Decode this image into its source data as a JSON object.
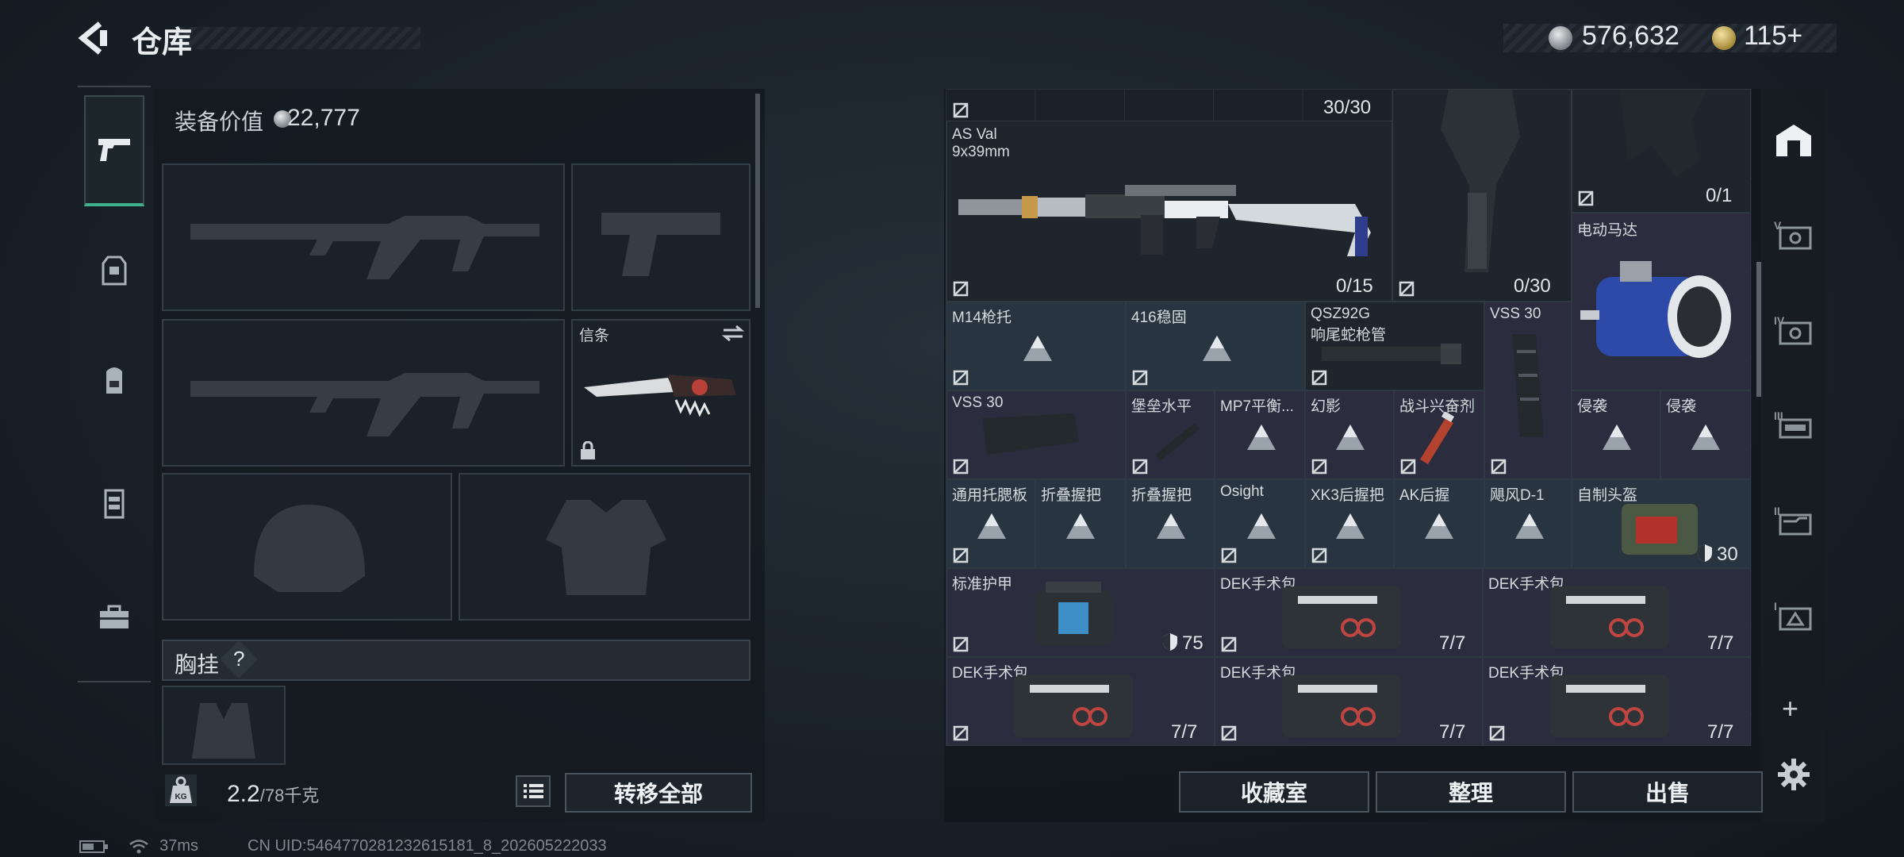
{
  "header": {
    "title": "仓库",
    "money": "576,632",
    "tickets": "115",
    "tickets_plus": "+"
  },
  "left_nav": [
    "gun-icon",
    "backpack-armor-icon",
    "backpack-icon",
    "vest-icon",
    "toolbox-icon"
  ],
  "equipment": {
    "value_label": "装备价值",
    "value": "22,777",
    "melee_label": "信条",
    "chest_rig_label": "胸挂",
    "chest_rig_help": "?",
    "weight": "2.2",
    "weight_max": "/78千克",
    "weight_badge": "KG",
    "transfer_all": "转移全部"
  },
  "stash": {
    "top_count": "30/30",
    "items": [
      {
        "name": "AS Val",
        "sub": "9x39mm",
        "count": "0/15"
      },
      {
        "name": "",
        "count": "0/30"
      },
      {
        "name": "",
        "count": "0/1"
      },
      {
        "name": "电动马达"
      },
      {
        "name": "M14枪托"
      },
      {
        "name": "416稳固"
      },
      {
        "name": "QSZ92G",
        "sub": "响尾蛇枪管"
      },
      {
        "name": "VSS 30"
      },
      {
        "name": "VSS 30"
      },
      {
        "name": "堡垒水平"
      },
      {
        "name": "MP7平衡..."
      },
      {
        "name": "幻影"
      },
      {
        "name": "战斗兴奋剂"
      },
      {
        "name": "侵袭"
      },
      {
        "name": "侵袭"
      },
      {
        "name": "通用托腮板"
      },
      {
        "name": "折叠握把"
      },
      {
        "name": "折叠握把"
      },
      {
        "name": "Osight"
      },
      {
        "name": "XK3后握把"
      },
      {
        "name": "AK后握"
      },
      {
        "name": "飓风D-1"
      },
      {
        "name": "自制头盔",
        "count": "30"
      },
      {
        "name": "标准护甲",
        "count": "75"
      },
      {
        "name": "DEK手术包",
        "count": "7/7"
      },
      {
        "name": "DEK手术包",
        "count": "7/7"
      },
      {
        "name": "DEK手术包",
        "count": "7/7"
      },
      {
        "name": "DEK手术包",
        "count": "7/7"
      },
      {
        "name": "DEK手术包",
        "count": "7/7"
      }
    ],
    "buttons": [
      "收藏室",
      "整理",
      "出售"
    ]
  },
  "right_nav": [
    "home-base-icon",
    "tab-v-icon",
    "tab-iv-icon",
    "tab-iii-icon",
    "tab-ii-icon",
    "tab-i-icon"
  ],
  "right_nav_add": "+",
  "status": {
    "ping": "37ms",
    "uid": "CN UID:5464770281232615181_8_202605222033"
  },
  "colors": {
    "accent_green": "#3fb08a",
    "panel": "#1a2128"
  }
}
